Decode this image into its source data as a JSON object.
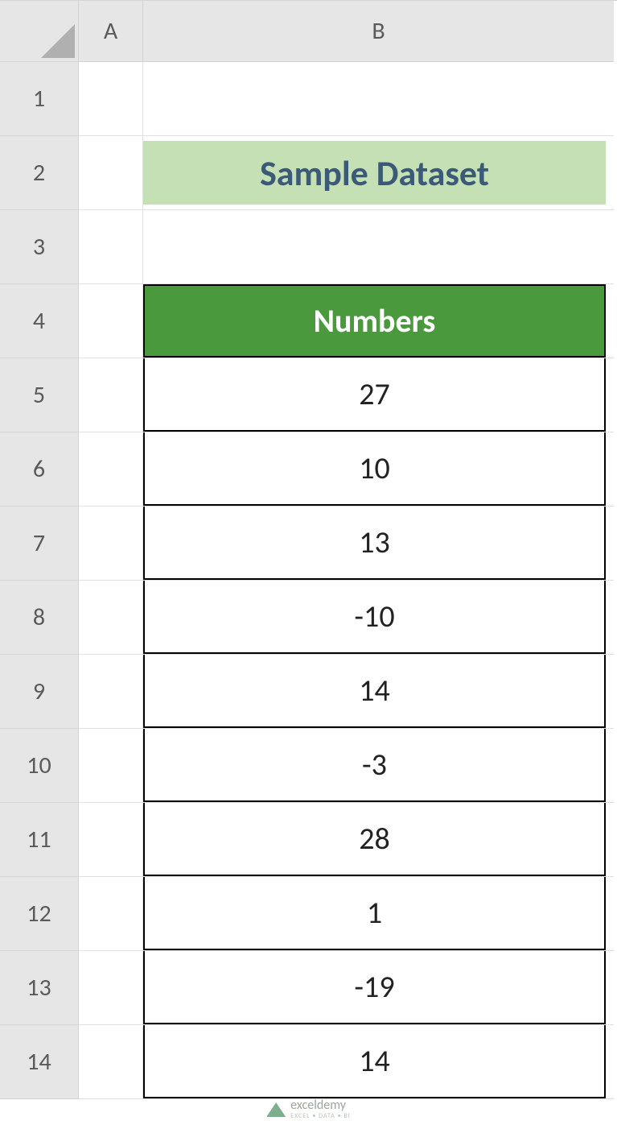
{
  "columns": [
    "A",
    "B"
  ],
  "rows": [
    "1",
    "2",
    "3",
    "4",
    "5",
    "6",
    "7",
    "8",
    "9",
    "10",
    "11",
    "12",
    "13",
    "14"
  ],
  "title": "Sample Dataset",
  "table": {
    "header": "Numbers",
    "values": [
      "27",
      "10",
      "13",
      "-10",
      "14",
      "-3",
      "28",
      "1",
      "-19",
      "14"
    ]
  },
  "watermark": {
    "name": "exceldemy",
    "tag": "EXCEL • DATA • BI"
  }
}
